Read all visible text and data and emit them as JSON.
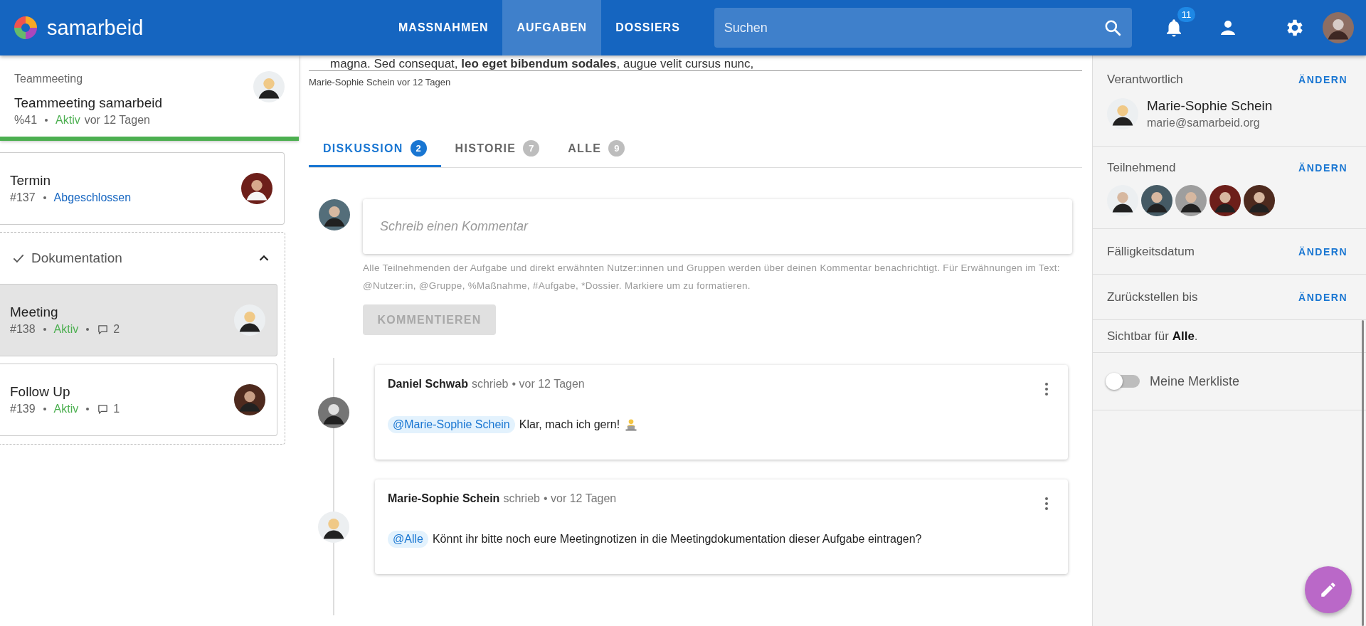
{
  "header": {
    "brand": "samarbeid",
    "nav": [
      {
        "label": "MASSNAHMEN",
        "selected": false
      },
      {
        "label": "AUFGABEN",
        "selected": true
      },
      {
        "label": "DOSSIERS",
        "selected": false
      }
    ],
    "search": {
      "placeholder": "Suchen"
    },
    "notification_count": "11"
  },
  "sidebar": {
    "parent": {
      "kicker": "Teammeeting",
      "title": "Teammeeting samarbeid",
      "id": "%41",
      "status": "Aktiv",
      "color": "#4caf50",
      "time": "vor 12 Tagen",
      "level": 1
    },
    "tasks": [
      {
        "title": "Termin",
        "id": "#137",
        "status": "Abgeschlossen",
        "color": "#1565c0",
        "selected": false
      }
    ],
    "group": {
      "title": "Dokumentation",
      "expanded": true,
      "tasks": [
        {
          "title": "Meeting",
          "id": "#138",
          "status": "Aktiv",
          "color": "#4caf50",
          "comments": "2",
          "selected": true
        },
        {
          "title": "Follow Up",
          "id": "#139",
          "status": "Aktiv",
          "color": "#4caf50",
          "comments": "1",
          "selected": false
        }
      ]
    }
  },
  "content": {
    "excerpt": "magna. Sed consequat, **leo eget bibendum sodales**, augue velit cursus nunc,",
    "byline": "Marie-Sophie Schein vor 12 Tagen",
    "tabs": [
      {
        "label": "DISKUSSION",
        "count": "2",
        "selected": true
      },
      {
        "label": "HISTORIE",
        "count": "7",
        "selected": false
      },
      {
        "label": "ALLE",
        "count": "9",
        "selected": false
      }
    ],
    "composer": {
      "placeholder": "Schreib einen Kommentar",
      "hint": "Alle Teilnehmenden der Aufgabe und direkt erwähnten Nutzer:innen und Gruppen werden über deinen Kommentar benachrichtigt. Für Erwähnungen im Text: @Nutzer:in, @Gruppe, %Maßnahme, #Aufgabe, *Dossier. Markiere um zu formatieren.",
      "button": "KOMMENTIEREN",
      "disabled": true
    },
    "comments": [
      {
        "author": "Daniel Schwab",
        "verb": "schrieb",
        "time": "• vor 12 Tagen",
        "mention": "@Marie-Sophie Schein",
        "text": "Klar, mach ich gern!",
        "emoji": true
      },
      {
        "author": "Marie-Sophie Schein",
        "verb": "schrieb",
        "time": "• vor 12 Tagen",
        "mention": "@Alle",
        "text": "Könnt ihr bitte noch eure Meetingnotizen in die Meetingdokumentation dieser Aufgabe eintragen?",
        "emoji": false
      }
    ]
  },
  "details": {
    "responsible": {
      "label": "Verantwortlich",
      "action": "ÄNDERN",
      "name": "Marie-Sophie Schein",
      "email": "marie@samarbeid.org"
    },
    "participants": {
      "label": "Teilnehmend",
      "action": "ÄNDERN",
      "people": [
        {
          "kind": "avatar"
        },
        {
          "kind": "avatar"
        },
        {
          "kind": "avatar"
        },
        {
          "kind": "avatar"
        },
        {
          "kind": "avatar"
        }
      ]
    },
    "due": {
      "label": "Fälligkeitsdatum",
      "action": "ÄNDERN"
    },
    "defer": {
      "label": "Zurückstellen bis",
      "action": "ÄNDERN"
    },
    "visibility": "Sichtbar für **Alle**.",
    "watchlist": {
      "label": "Meine Merkliste",
      "on": false
    }
  }
}
